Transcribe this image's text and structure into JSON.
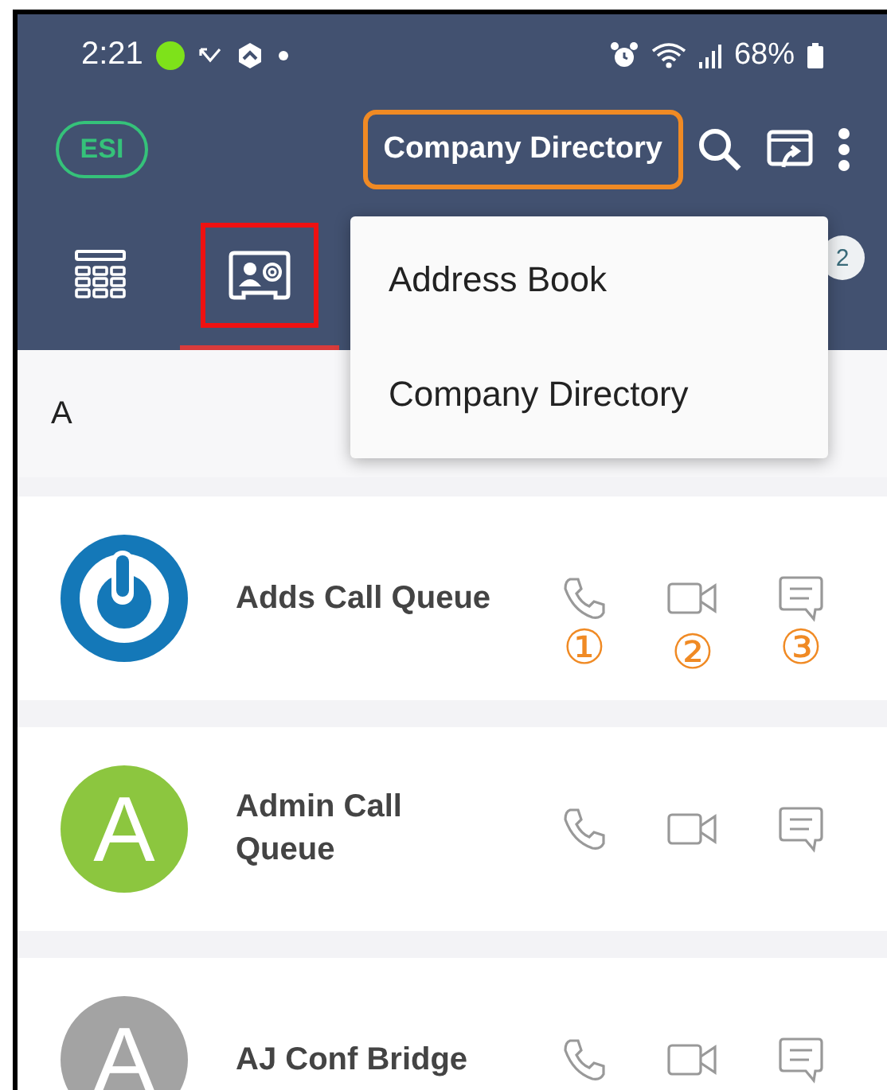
{
  "status_bar": {
    "time": "2:21",
    "battery": "68%"
  },
  "header": {
    "account": "ESI",
    "title": "Company Directory",
    "title_highlighted": true
  },
  "tabs": [
    {
      "kind": "dialpad",
      "selected": false,
      "highlighted": false
    },
    {
      "kind": "contacts",
      "selected": true,
      "highlighted": true
    },
    {
      "kind": "badge",
      "badge": "2",
      "selected": false,
      "highlighted": false
    }
  ],
  "menu": {
    "items": [
      "Address Book",
      "Company Directory"
    ]
  },
  "section": {
    "letter": "A"
  },
  "contacts": [
    {
      "name": "Adds Call Queue",
      "avatar": {
        "kind": "logo"
      },
      "markers": [
        "①",
        "②",
        "③"
      ]
    },
    {
      "name": "Admin Call\nQueue",
      "avatar": {
        "kind": "letter",
        "letter": "A",
        "color": "#8cc63f"
      }
    },
    {
      "name": "AJ Conf Bridge",
      "avatar": {
        "kind": "letter",
        "letter": "A",
        "color": "#a3a3a3"
      }
    }
  ]
}
